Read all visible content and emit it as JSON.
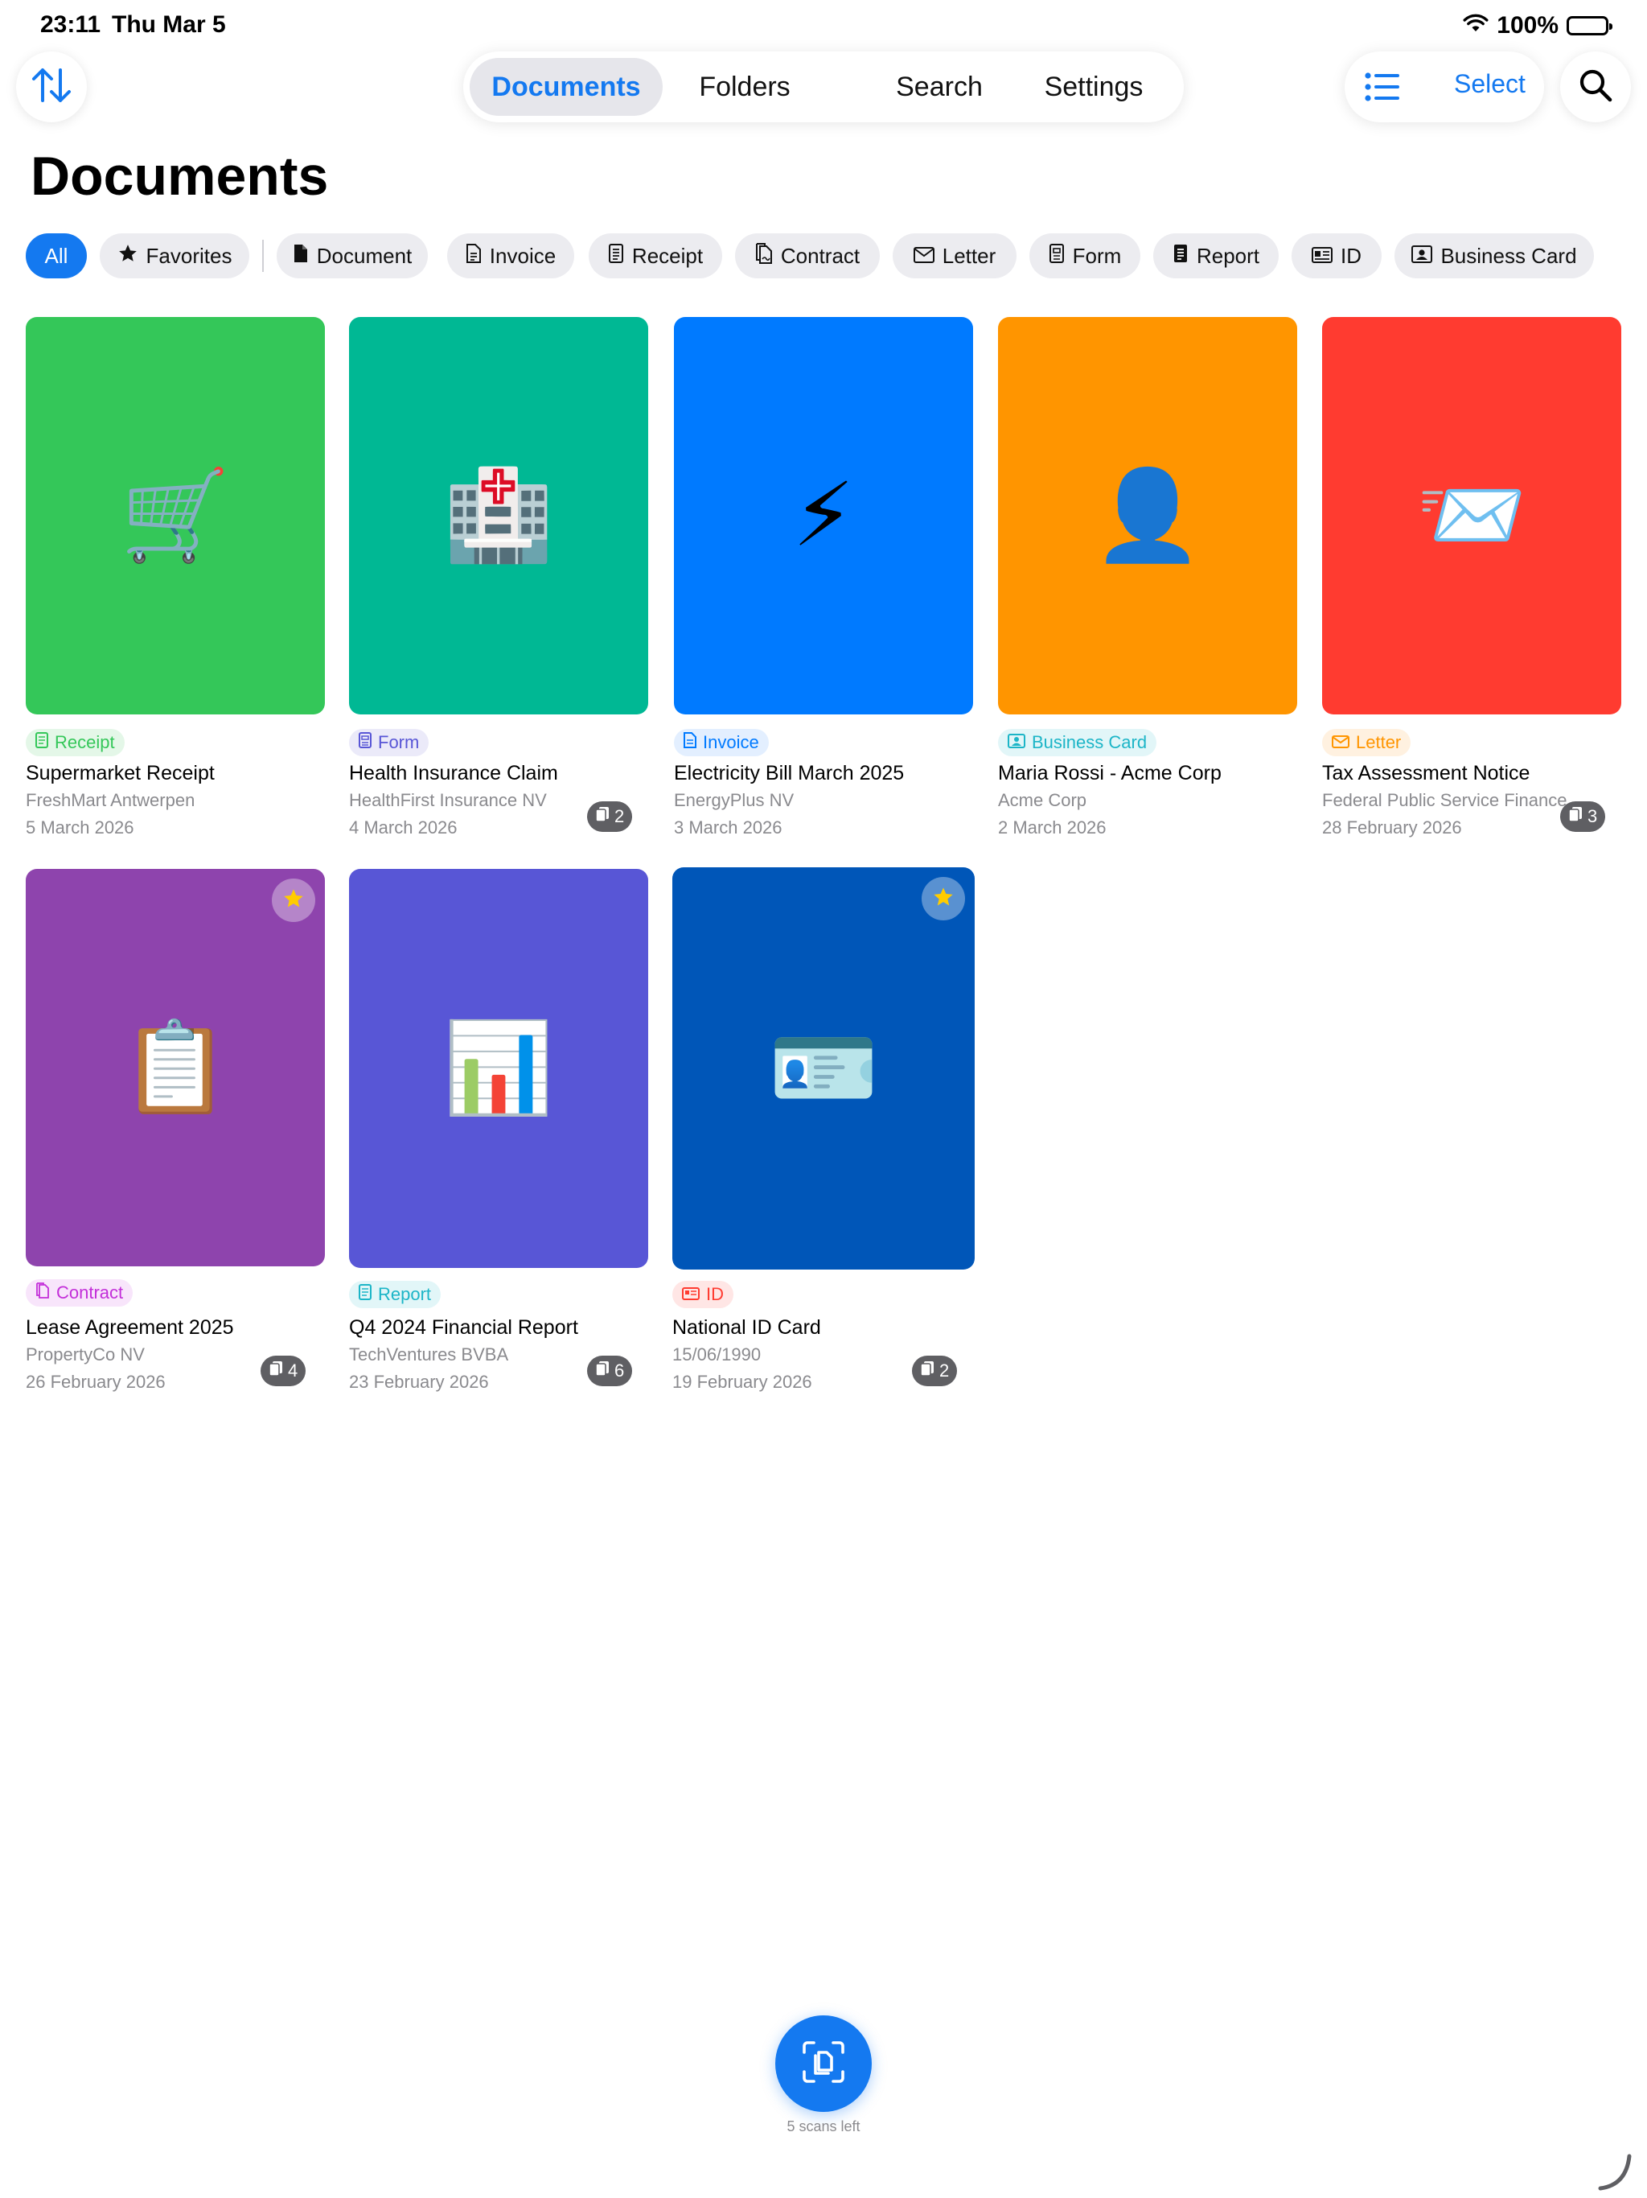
{
  "status_bar": {
    "time": "23:11",
    "date": "Thu Mar 5",
    "battery": "100%"
  },
  "nav": {
    "tabs": [
      {
        "label": "Documents",
        "active": true
      },
      {
        "label": "Folders",
        "active": false
      },
      {
        "label": "Search",
        "active": false
      },
      {
        "label": "Settings",
        "active": false
      }
    ],
    "select_label": "Select",
    "accent_color": "#1479f0"
  },
  "page": {
    "title": "Documents"
  },
  "filters": [
    {
      "label": "All",
      "icon": "",
      "active": true
    },
    {
      "label": "Favorites",
      "icon": "star-icon",
      "active": false
    },
    {
      "label": "Document",
      "icon": "document-icon",
      "active": false
    },
    {
      "label": "Invoice",
      "icon": "invoice-icon",
      "active": false
    },
    {
      "label": "Receipt",
      "icon": "receipt-icon",
      "active": false
    },
    {
      "label": "Contract",
      "icon": "contract-icon",
      "active": false
    },
    {
      "label": "Letter",
      "icon": "envelope-icon",
      "active": false
    },
    {
      "label": "Form",
      "icon": "form-icon",
      "active": false
    },
    {
      "label": "Report",
      "icon": "report-icon",
      "active": false
    },
    {
      "label": "ID",
      "icon": "id-card-icon",
      "active": false
    },
    {
      "label": "Business Card",
      "icon": "business-card-icon",
      "active": false
    }
  ],
  "documents": [
    {
      "type": "Receipt",
      "title": "Supermarket Receipt",
      "subtitle": "FreshMart Antwerpen",
      "date": "5 March 2026",
      "pages": "",
      "favorite": false,
      "color": "#34c759",
      "emoji": "🛒",
      "tag_color": "#34c759",
      "tag_bg": "#e4f7e8"
    },
    {
      "type": "Form",
      "title": "Health Insurance Claim",
      "subtitle": "HealthFirst Insurance NV",
      "date": "4 March 2026",
      "pages": "2",
      "favorite": false,
      "color": "#00b894",
      "emoji": "🏥",
      "tag_color": "#5856d6",
      "tag_bg": "#ebeaf9"
    },
    {
      "type": "Invoice",
      "title": "Electricity Bill March 2025",
      "subtitle": "EnergyPlus NV",
      "date": "3 March 2026",
      "pages": "",
      "favorite": false,
      "color": "#007aff",
      "emoji": "⚡",
      "tag_color": "#007aff",
      "tag_bg": "#e3efff"
    },
    {
      "type": "Business Card",
      "title": "Maria Rossi - Acme Corp",
      "subtitle": "Acme Corp",
      "date": "2 March 2026",
      "pages": "",
      "favorite": false,
      "color": "#ff9500",
      "emoji": "👤",
      "tag_color": "#1cb5c7",
      "tag_bg": "#e2f6f8"
    },
    {
      "type": "Letter",
      "title": "Tax Assessment Notice",
      "subtitle": "Federal Public Service Finance",
      "date": "28 February 2026",
      "pages": "3",
      "favorite": false,
      "color": "#ff3b30",
      "emoji": "📨",
      "tag_color": "#ff9500",
      "tag_bg": "#fff1e0"
    },
    {
      "type": "Contract",
      "title": "Lease Agreement 2025",
      "subtitle": "PropertyCo NV",
      "date": "26 February 2026",
      "pages": "4",
      "favorite": true,
      "color": "#8e44ad",
      "emoji": "📋",
      "tag_color": "#c32fd9",
      "tag_bg": "#f8e5fb"
    },
    {
      "type": "Report",
      "title": "Q4 2024 Financial Report",
      "subtitle": "TechVentures BVBA",
      "date": "23 February 2026",
      "pages": "6",
      "favorite": false,
      "color": "#5856d6",
      "emoji": "📊",
      "tag_color": "#1cb5c7",
      "tag_bg": "#e2f6f8"
    },
    {
      "type": "ID",
      "title": "National ID Card",
      "subtitle": "15/06/1990",
      "date": "19 February 2026",
      "pages": "2",
      "favorite": true,
      "color": "#0056b8",
      "emoji": "🪪",
      "tag_color": "#ff3b30",
      "tag_bg": "#ffe6e5"
    }
  ],
  "fab": {
    "scans_left": "5 scans left"
  }
}
